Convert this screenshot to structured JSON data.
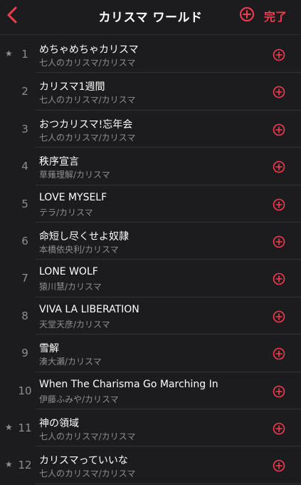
{
  "header": {
    "title": "カリスマ ワールド",
    "done_label": "完了",
    "accent_color": "#fa3a50",
    "back_icon": "chevron-left-icon",
    "add_icon": "plus-circle-icon"
  },
  "tracks": [
    {
      "number": "1",
      "starred": true,
      "title": "めちゃめちゃカリスマ",
      "artist_album": "七人のカリスマ/カリスマ"
    },
    {
      "number": "2",
      "starred": false,
      "title": "カリスマ1週間",
      "artist_album": "七人のカリスマ/カリスマ"
    },
    {
      "number": "3",
      "starred": false,
      "title": "おつカリスマ!忘年会",
      "artist_album": "七人のカリスマ/カリスマ"
    },
    {
      "number": "4",
      "starred": false,
      "title": "秩序宣言",
      "artist_album": "草薙理解/カリスマ"
    },
    {
      "number": "5",
      "starred": false,
      "title": "LOVE MYSELF",
      "artist_album": "テラ/カリスマ"
    },
    {
      "number": "6",
      "starred": false,
      "title": "命短し尽くせよ奴隷",
      "artist_album": "本橋依央利/カリスマ"
    },
    {
      "number": "7",
      "starred": false,
      "title": "LONE WOLF",
      "artist_album": "猿川慧/カリスマ"
    },
    {
      "number": "8",
      "starred": false,
      "title": "VIVA LA LIBERATION",
      "artist_album": "天堂天彦/カリスマ"
    },
    {
      "number": "9",
      "starred": false,
      "title": "雪解",
      "artist_album": "湊大瀬/カリスマ"
    },
    {
      "number": "10",
      "starred": false,
      "title": "When The Charisma Go Marching In",
      "artist_album": "伊藤ふみや/カリスマ"
    },
    {
      "number": "11",
      "starred": true,
      "title": "神の領域",
      "artist_album": "七人のカリスマ/カリスマ"
    },
    {
      "number": "12",
      "starred": true,
      "title": "カリスマっていいな",
      "artist_album": "七人のカリスマ/カリスマ"
    }
  ],
  "star_glyph": "★"
}
